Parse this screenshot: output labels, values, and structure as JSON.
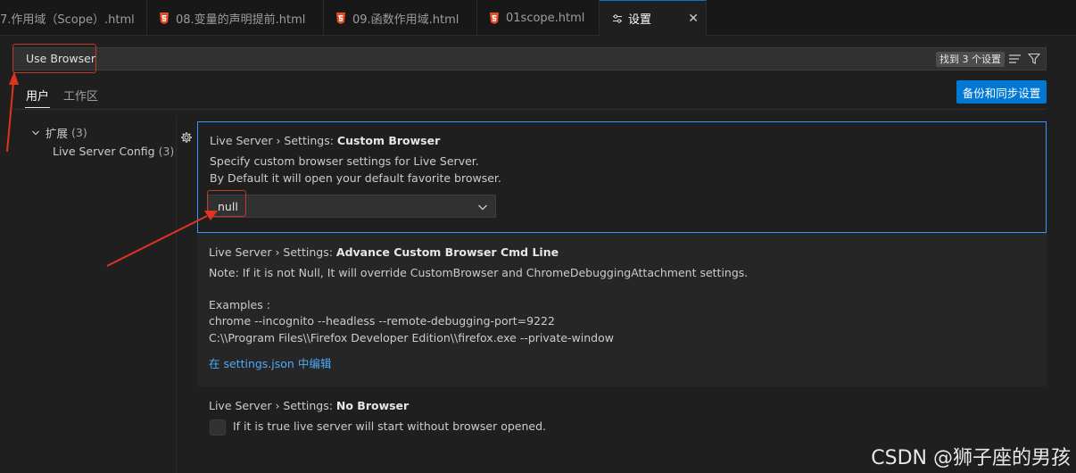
{
  "tabs": [
    {
      "label": "7.作用域（Scope）.html"
    },
    {
      "label": "08.变量的声明提前.html"
    },
    {
      "label": "09.函数作用域.html"
    },
    {
      "label": "01scope.html"
    },
    {
      "label": "设置",
      "active": true
    }
  ],
  "search": {
    "value": "Use Browser",
    "result_count": "找到 3 个设置"
  },
  "scope_tabs": {
    "user": "用户",
    "workspace": "工作区"
  },
  "sync_button": "备份和同步设置",
  "tree": {
    "extensions_label": "扩展",
    "extensions_count": "(3)",
    "live_server_label": "Live Server Config",
    "live_server_count": "(3)"
  },
  "settings": [
    {
      "category": "Live Server › Settings: ",
      "name": "Custom Browser",
      "description": [
        "Specify custom browser settings for Live Server.",
        "By Default it will open your default favorite browser."
      ],
      "value": "null"
    },
    {
      "category": "Live Server › Settings: ",
      "name": "Advance Custom Browser Cmd Line",
      "description": [
        "Note: If it is not Null, It will override CustomBrowser and ChromeDebuggingAttachment settings.",
        "Examples :",
        "chrome --incognito --headless --remote-debugging-port=9222",
        "C:\\\\Program Files\\\\Firefox Developer Edition\\\\firefox.exe --private-window"
      ],
      "link": "在 settings.json 中编辑"
    },
    {
      "category": "Live Server › Settings: ",
      "name": "No Browser",
      "description": [
        "If it is true live server will start without browser opened."
      ],
      "checked": false
    }
  ],
  "watermark": "CSDN @狮子座的男孩",
  "colors": {
    "accent": "#0078d4",
    "focus_border": "#3794ff",
    "annotation_red": "#c0392b",
    "html_icon": "#e44d26"
  }
}
